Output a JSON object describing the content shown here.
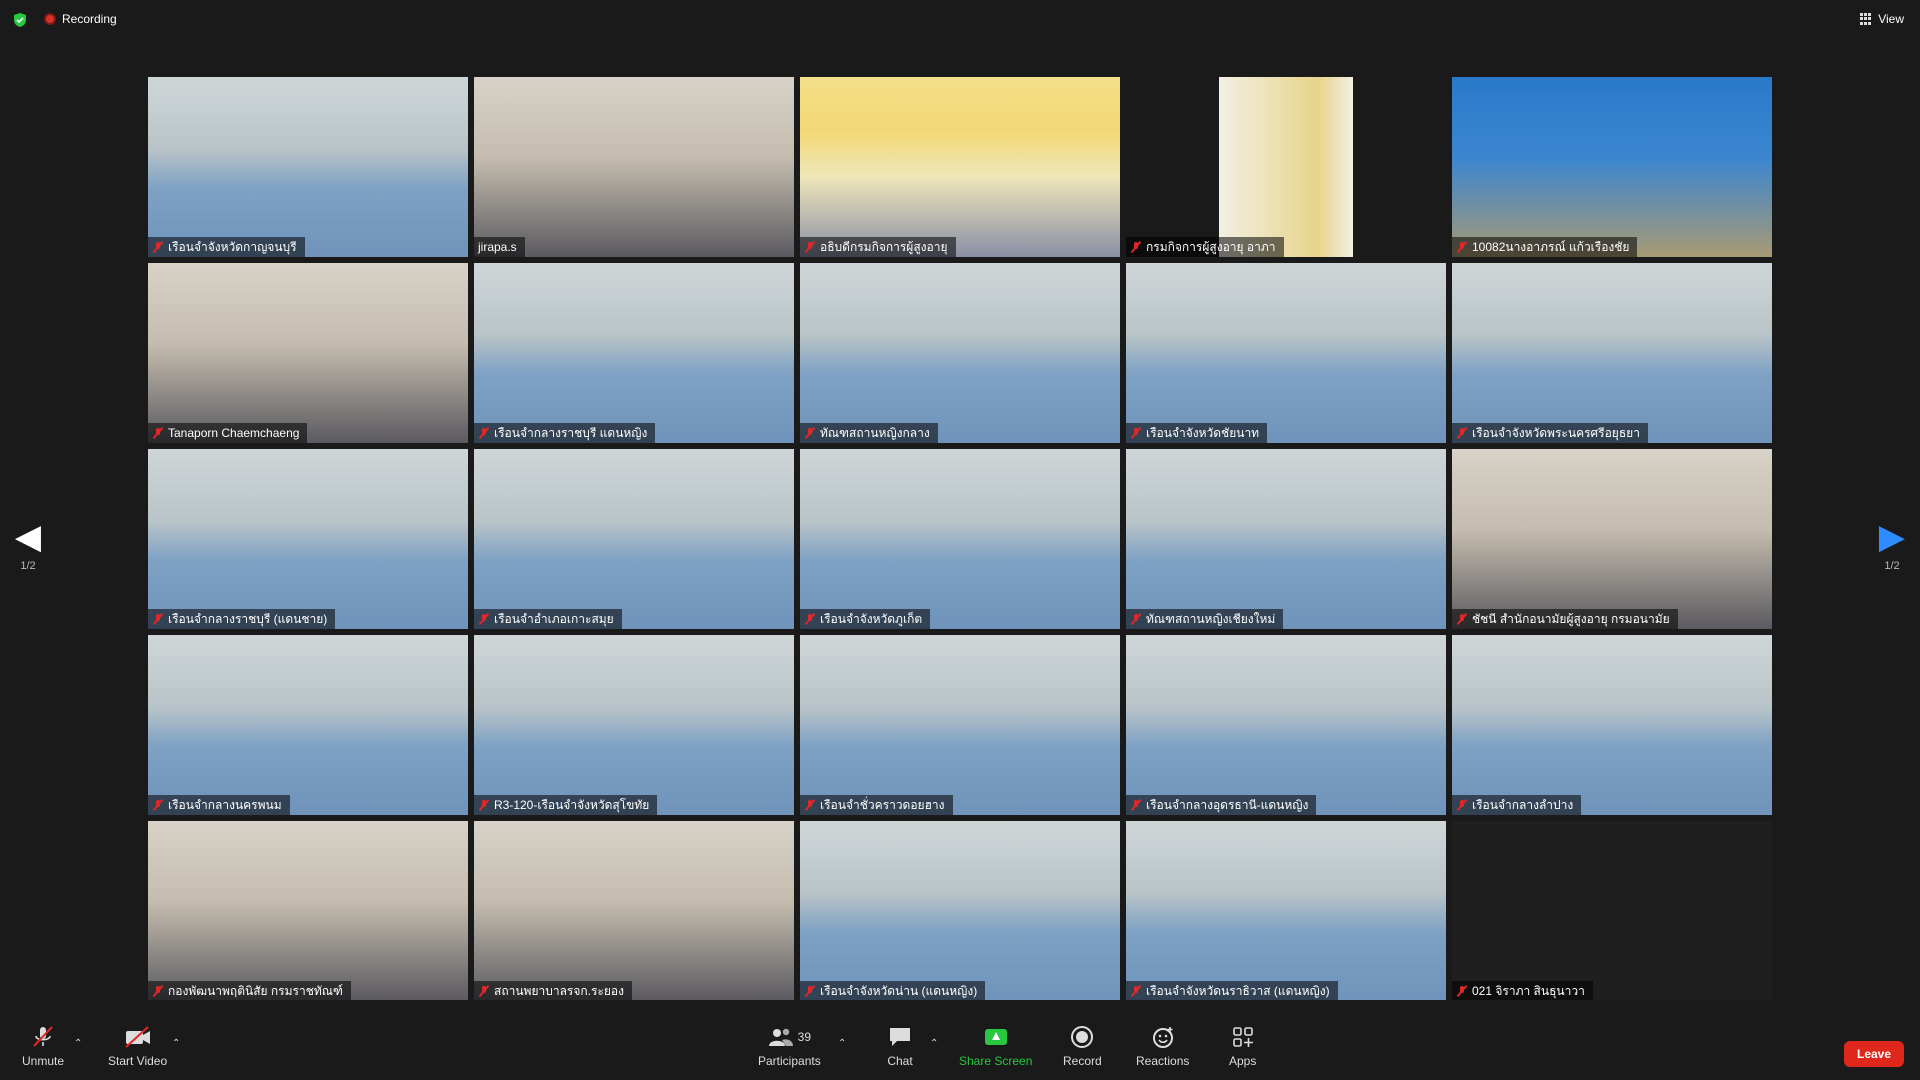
{
  "topbar": {
    "recording_label": "Recording",
    "view_label": "View"
  },
  "pager": {
    "left_page": "1/2",
    "right_page": "1/2"
  },
  "participants": [
    {
      "name": "เรือนจำจังหวัดกาญจนบุรี",
      "muted": true,
      "scene": "group",
      "active": false
    },
    {
      "name": "jirapa.s",
      "muted": false,
      "scene": "portrait",
      "active": true
    },
    {
      "name": "อธิบดีกรมกิจการผู้สูงอายุ",
      "muted": true,
      "scene": "banner-portrait",
      "active": false
    },
    {
      "name": "กรมกิจการผู้สูงอายุ อาภา",
      "muted": true,
      "scene": "yellow-portrait",
      "active": false
    },
    {
      "name": "10082นางอาภรณ์ แก้วเรืองชัย",
      "muted": true,
      "scene": "uniform-portrait",
      "active": false
    },
    {
      "name": "Tanaporn Chaemchaeng",
      "muted": true,
      "scene": "portrait",
      "active": false
    },
    {
      "name": "เรือนจำกลางราชบุรี แดนหญิง",
      "muted": true,
      "scene": "group",
      "active": false
    },
    {
      "name": "ทัณฑสถานหญิงกลาง",
      "muted": true,
      "scene": "group",
      "active": false
    },
    {
      "name": "เรือนจำจังหวัดชัยนาท",
      "muted": true,
      "scene": "group",
      "active": false
    },
    {
      "name": "เรือนจำจังหวัดพระนครศรีอยุธยา",
      "muted": true,
      "scene": "group",
      "active": false
    },
    {
      "name": "เรือนจำกลางราชบุรี (แดนชาย)",
      "muted": true,
      "scene": "group",
      "active": false
    },
    {
      "name": "เรือนจำอำเภอเกาะสมุย",
      "muted": true,
      "scene": "group",
      "active": false
    },
    {
      "name": "เรือนจำจังหวัดภูเก็ต",
      "muted": true,
      "scene": "group",
      "active": false
    },
    {
      "name": "ทัณฑสถานหญิงเชียงใหม่",
      "muted": true,
      "scene": "group",
      "active": false
    },
    {
      "name": "ชัชนี สำนักอนามัยผู้สูงอายุ กรมอนามัย",
      "muted": true,
      "scene": "portrait",
      "active": false
    },
    {
      "name": "เรือนจำกลางนครพนม",
      "muted": true,
      "scene": "group",
      "active": false
    },
    {
      "name": "R3-120-เรือนจำจังหวัดสุโขทัย",
      "muted": true,
      "scene": "group",
      "active": false
    },
    {
      "name": "เรือนจำชั่วคราวดอยฮาง",
      "muted": true,
      "scene": "group",
      "active": false
    },
    {
      "name": "เรือนจำกลางอุดรธานี-แดนหญิง",
      "muted": true,
      "scene": "group",
      "active": false
    },
    {
      "name": "เรือนจำกลางลำปาง",
      "muted": true,
      "scene": "group",
      "active": false
    },
    {
      "name": "กองพัฒนาพฤตินิสัย กรมราชทัณฑ์",
      "muted": true,
      "scene": "portrait",
      "active": false
    },
    {
      "name": "สถานพยาบาลรจก.ระยอง",
      "muted": true,
      "scene": "portrait",
      "active": false
    },
    {
      "name": "เรือนจำจังหวัดน่าน (แดนหญิง)",
      "muted": true,
      "scene": "group",
      "active": false
    },
    {
      "name": "เรือนจำจังหวัดนราธิวาส (แดนหญิง)",
      "muted": true,
      "scene": "group",
      "active": false
    },
    {
      "name": "021 จิราภา สินธุนาวา",
      "muted": true,
      "scene": "empty",
      "active": false
    }
  ],
  "footer": {
    "unmute_label": "Unmute",
    "start_video_label": "Start Video",
    "participants_label": "Participants",
    "participants_count": "39",
    "chat_label": "Chat",
    "share_screen_label": "Share Screen",
    "record_label": "Record",
    "reactions_label": "Reactions",
    "apps_label": "Apps",
    "leave_label": "Leave"
  },
  "colors": {
    "background": "#1a1a1a",
    "active_speaker": "#c5d95b",
    "share_green": "#28c840",
    "leave_red": "#e0271b",
    "pager_blue": "#2d8cff"
  }
}
